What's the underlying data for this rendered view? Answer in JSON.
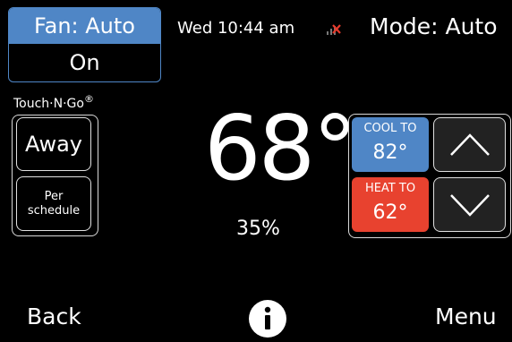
{
  "fan": {
    "mode_label": "Fan: Auto",
    "state_label": "On"
  },
  "status": {
    "datetime": "Wed 10:44 am",
    "wifi_icon": "wifi-disconnected-icon",
    "mode_label": "Mode: Auto"
  },
  "brand": {
    "name": "Touch·N·Go",
    "mark": "®"
  },
  "side_buttons": {
    "away": "Away",
    "schedule_line1": "Per",
    "schedule_line2": "schedule"
  },
  "current": {
    "temperature": "68°",
    "humidity": "35%"
  },
  "setpoints": {
    "cool": {
      "label": "COOL TO",
      "value": "82°",
      "color": "#4f86c6"
    },
    "heat": {
      "label": "HEAT TO",
      "value": "62°",
      "color": "#e8422f"
    }
  },
  "arrows": {
    "up_icon": "chevron-up-icon",
    "down_icon": "chevron-down-icon"
  },
  "footer": {
    "back_label": "Back",
    "info_icon": "info-icon",
    "menu_label": "Menu"
  }
}
